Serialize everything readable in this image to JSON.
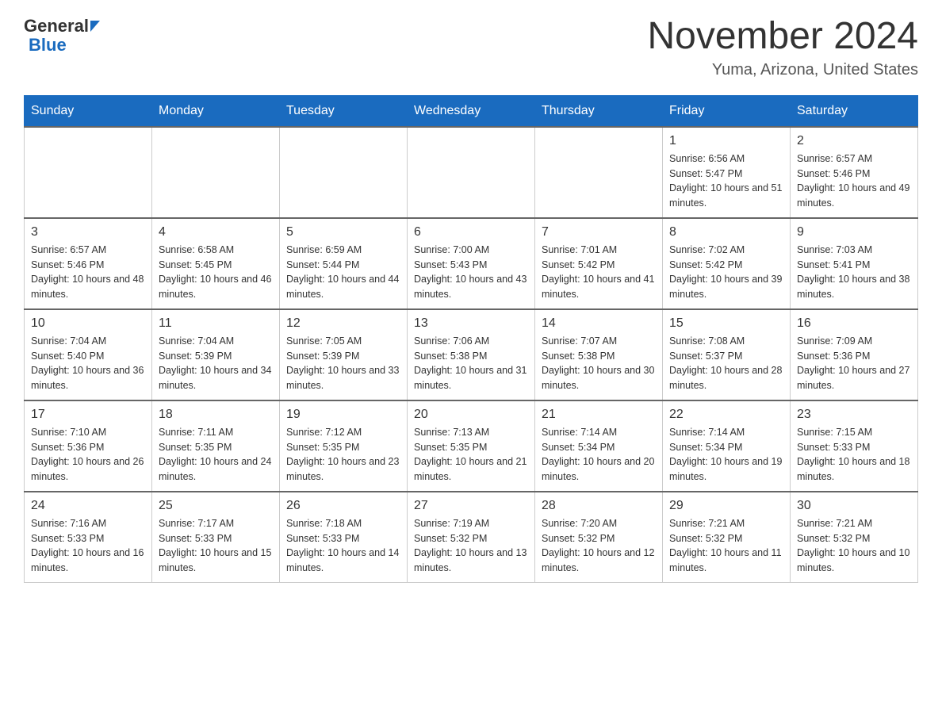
{
  "header": {
    "logo_general": "General",
    "logo_blue": "Blue",
    "month_title": "November 2024",
    "location": "Yuma, Arizona, United States"
  },
  "calendar": {
    "days_of_week": [
      "Sunday",
      "Monday",
      "Tuesday",
      "Wednesday",
      "Thursday",
      "Friday",
      "Saturday"
    ],
    "weeks": [
      [
        {
          "day": "",
          "info": ""
        },
        {
          "day": "",
          "info": ""
        },
        {
          "day": "",
          "info": ""
        },
        {
          "day": "",
          "info": ""
        },
        {
          "day": "",
          "info": ""
        },
        {
          "day": "1",
          "info": "Sunrise: 6:56 AM\nSunset: 5:47 PM\nDaylight: 10 hours and 51 minutes."
        },
        {
          "day": "2",
          "info": "Sunrise: 6:57 AM\nSunset: 5:46 PM\nDaylight: 10 hours and 49 minutes."
        }
      ],
      [
        {
          "day": "3",
          "info": "Sunrise: 6:57 AM\nSunset: 5:46 PM\nDaylight: 10 hours and 48 minutes."
        },
        {
          "day": "4",
          "info": "Sunrise: 6:58 AM\nSunset: 5:45 PM\nDaylight: 10 hours and 46 minutes."
        },
        {
          "day": "5",
          "info": "Sunrise: 6:59 AM\nSunset: 5:44 PM\nDaylight: 10 hours and 44 minutes."
        },
        {
          "day": "6",
          "info": "Sunrise: 7:00 AM\nSunset: 5:43 PM\nDaylight: 10 hours and 43 minutes."
        },
        {
          "day": "7",
          "info": "Sunrise: 7:01 AM\nSunset: 5:42 PM\nDaylight: 10 hours and 41 minutes."
        },
        {
          "day": "8",
          "info": "Sunrise: 7:02 AM\nSunset: 5:42 PM\nDaylight: 10 hours and 39 minutes."
        },
        {
          "day": "9",
          "info": "Sunrise: 7:03 AM\nSunset: 5:41 PM\nDaylight: 10 hours and 38 minutes."
        }
      ],
      [
        {
          "day": "10",
          "info": "Sunrise: 7:04 AM\nSunset: 5:40 PM\nDaylight: 10 hours and 36 minutes."
        },
        {
          "day": "11",
          "info": "Sunrise: 7:04 AM\nSunset: 5:39 PM\nDaylight: 10 hours and 34 minutes."
        },
        {
          "day": "12",
          "info": "Sunrise: 7:05 AM\nSunset: 5:39 PM\nDaylight: 10 hours and 33 minutes."
        },
        {
          "day": "13",
          "info": "Sunrise: 7:06 AM\nSunset: 5:38 PM\nDaylight: 10 hours and 31 minutes."
        },
        {
          "day": "14",
          "info": "Sunrise: 7:07 AM\nSunset: 5:38 PM\nDaylight: 10 hours and 30 minutes."
        },
        {
          "day": "15",
          "info": "Sunrise: 7:08 AM\nSunset: 5:37 PM\nDaylight: 10 hours and 28 minutes."
        },
        {
          "day": "16",
          "info": "Sunrise: 7:09 AM\nSunset: 5:36 PM\nDaylight: 10 hours and 27 minutes."
        }
      ],
      [
        {
          "day": "17",
          "info": "Sunrise: 7:10 AM\nSunset: 5:36 PM\nDaylight: 10 hours and 26 minutes."
        },
        {
          "day": "18",
          "info": "Sunrise: 7:11 AM\nSunset: 5:35 PM\nDaylight: 10 hours and 24 minutes."
        },
        {
          "day": "19",
          "info": "Sunrise: 7:12 AM\nSunset: 5:35 PM\nDaylight: 10 hours and 23 minutes."
        },
        {
          "day": "20",
          "info": "Sunrise: 7:13 AM\nSunset: 5:35 PM\nDaylight: 10 hours and 21 minutes."
        },
        {
          "day": "21",
          "info": "Sunrise: 7:14 AM\nSunset: 5:34 PM\nDaylight: 10 hours and 20 minutes."
        },
        {
          "day": "22",
          "info": "Sunrise: 7:14 AM\nSunset: 5:34 PM\nDaylight: 10 hours and 19 minutes."
        },
        {
          "day": "23",
          "info": "Sunrise: 7:15 AM\nSunset: 5:33 PM\nDaylight: 10 hours and 18 minutes."
        }
      ],
      [
        {
          "day": "24",
          "info": "Sunrise: 7:16 AM\nSunset: 5:33 PM\nDaylight: 10 hours and 16 minutes."
        },
        {
          "day": "25",
          "info": "Sunrise: 7:17 AM\nSunset: 5:33 PM\nDaylight: 10 hours and 15 minutes."
        },
        {
          "day": "26",
          "info": "Sunrise: 7:18 AM\nSunset: 5:33 PM\nDaylight: 10 hours and 14 minutes."
        },
        {
          "day": "27",
          "info": "Sunrise: 7:19 AM\nSunset: 5:32 PM\nDaylight: 10 hours and 13 minutes."
        },
        {
          "day": "28",
          "info": "Sunrise: 7:20 AM\nSunset: 5:32 PM\nDaylight: 10 hours and 12 minutes."
        },
        {
          "day": "29",
          "info": "Sunrise: 7:21 AM\nSunset: 5:32 PM\nDaylight: 10 hours and 11 minutes."
        },
        {
          "day": "30",
          "info": "Sunrise: 7:21 AM\nSunset: 5:32 PM\nDaylight: 10 hours and 10 minutes."
        }
      ]
    ]
  }
}
